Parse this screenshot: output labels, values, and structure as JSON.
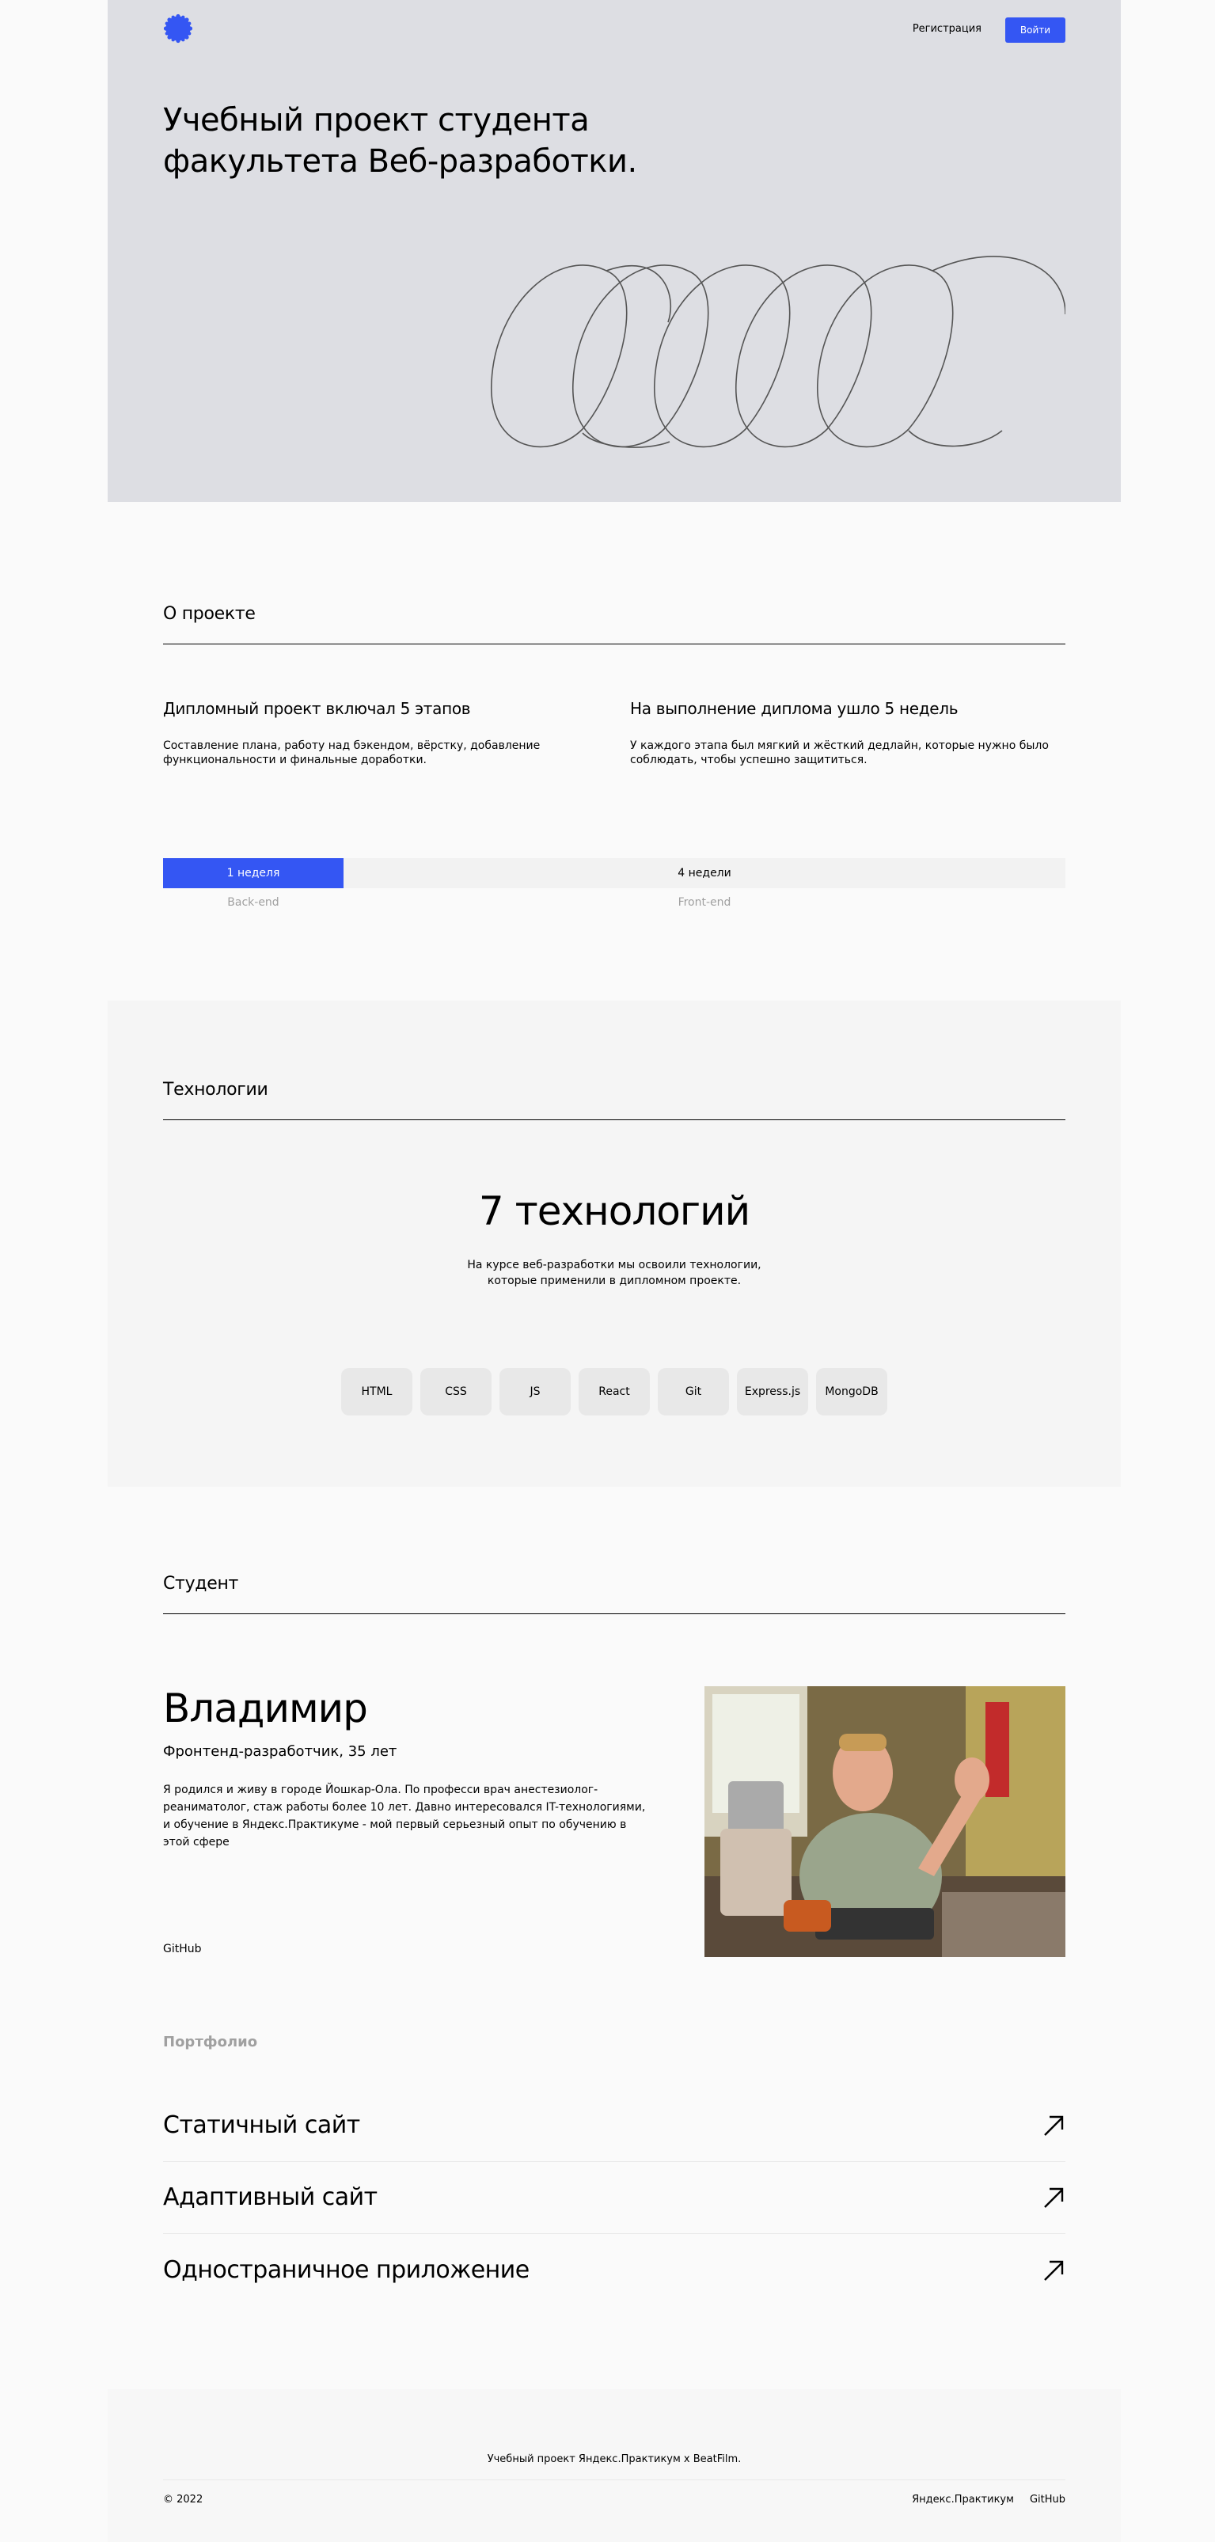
{
  "header": {
    "register_label": "Регистрация",
    "login_label": "Войти"
  },
  "promo": {
    "title_line1": "Учебный проект студента",
    "title_line2": "факультета Веб-разработки."
  },
  "about": {
    "title": "О проекте",
    "columns": [
      {
        "heading": "Дипломный проект включал 5 этапов",
        "text": "Составление плана, работу над бэкендом, вёрстку, добавление функциональности и финальные доработки."
      },
      {
        "heading": "На выполнение диплома ушло 5 недель",
        "text": "У каждого этапа был мягкий и жёсткий дедлайн, которые нужно было соблюдать, чтобы успешно защититься."
      }
    ],
    "timeline": {
      "bar1": "1 неделя",
      "bar2": "4 недели",
      "label1": "Back-end",
      "label2": "Front-end"
    }
  },
  "techs": {
    "title": "Технологии",
    "headline": "7 технологий",
    "subtitle": "На курсе веб-разработки мы освоили технологии, которые применили в дипломном проекте.",
    "items": [
      "HTML",
      "CSS",
      "JS",
      "React",
      "Git",
      "Express.js",
      "MongoDB"
    ]
  },
  "student": {
    "title": "Студент",
    "name": "Владимир",
    "job": "Фронтенд-разработчик, 35 лет",
    "description": "Я родился и живу в городе Йошкар-Ола. По професси врач анестезиолог-реаниматолог, стаж работы более 10 лет. Давно интересовался IT-технологиями, и обучение в Яндекс.Практикуме - мой первый серьезный опыт по обучению в этой сфере",
    "github_label": "GitHub"
  },
  "portfolio": {
    "title": "Портфолио",
    "items": [
      "Статичный сайт",
      "Адаптивный сайт",
      "Одностраничное приложение"
    ]
  },
  "footer": {
    "caption": "Учебный проект Яндекс.Практикум х BeatFilm.",
    "copyright": "© 2022",
    "link1": "Яндекс.Практикум",
    "link2": "GitHub"
  },
  "colors": {
    "accent": "#3456f3",
    "promo_bg": "#dddee3"
  }
}
